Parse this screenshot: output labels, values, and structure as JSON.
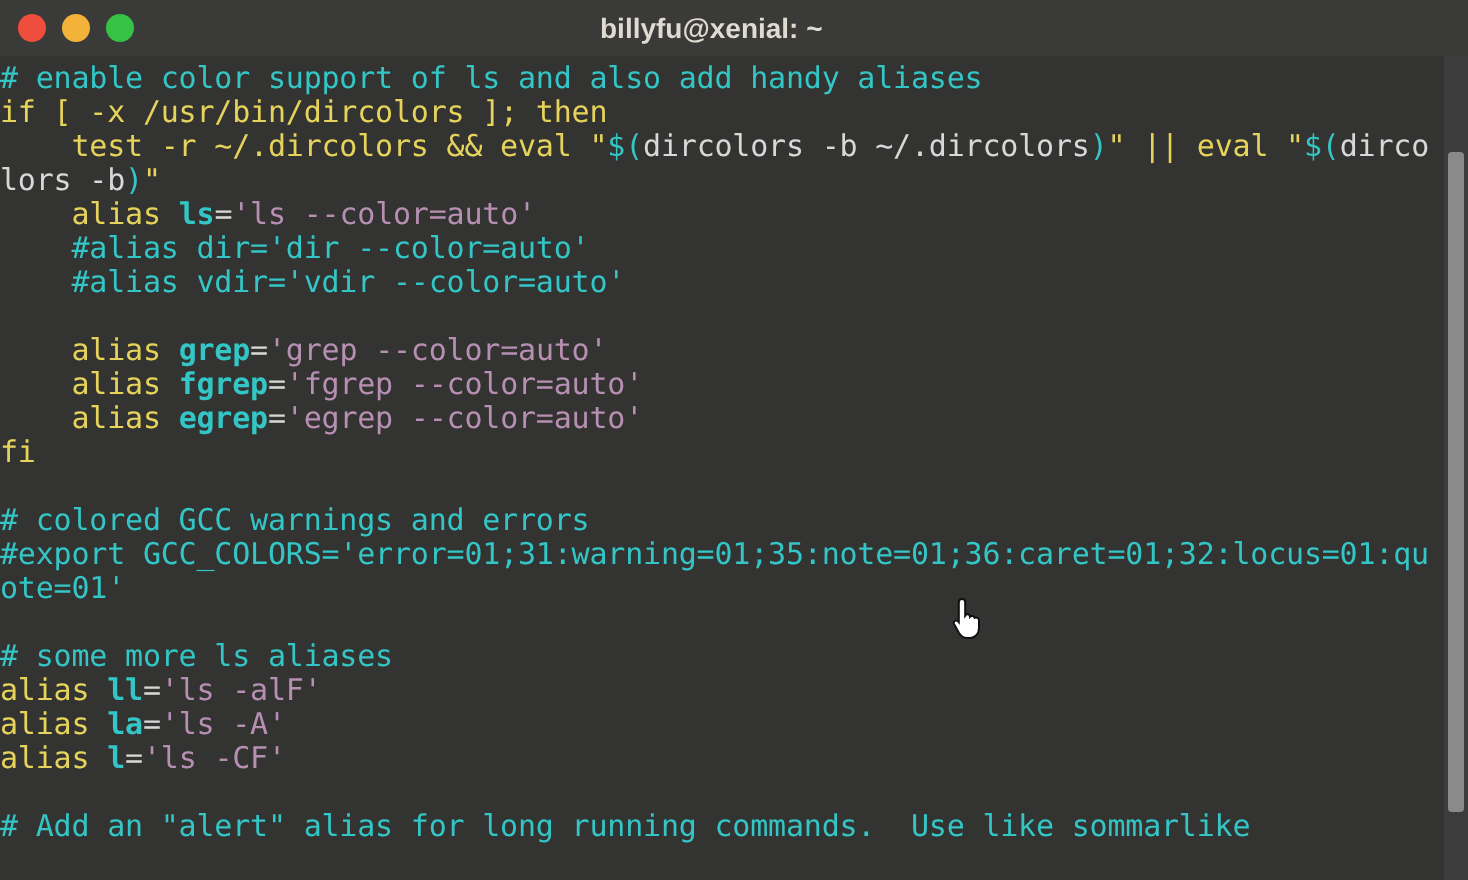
{
  "window": {
    "title": "billyfu@xenial: ~"
  },
  "terminal": {
    "blocks": [
      {
        "lines": [
          [
            {
              "kind": "comment",
              "text": "# enable color support of ls and also add handy aliases"
            }
          ],
          [
            {
              "kind": "keyword",
              "text": "if [ -x /usr/bin/dircolors ]; then"
            }
          ],
          [
            {
              "kind": "keyword",
              "text": "    test -r ~/.dircolors && eval \""
            },
            {
              "kind": "subst",
              "text": "$("
            },
            {
              "kind": "plain",
              "text": "dircolors -b ~/.dircolors"
            },
            {
              "kind": "subst",
              "text": ")"
            },
            {
              "kind": "keyword",
              "text": "\" || eval \""
            },
            {
              "kind": "subst",
              "text": "$("
            },
            {
              "kind": "plain",
              "text": "dirco"
            }
          ],
          [
            {
              "kind": "plain",
              "text": "lors -b"
            },
            {
              "kind": "subst",
              "text": ")"
            },
            {
              "kind": "keyword",
              "text": "\""
            }
          ],
          [
            {
              "kind": "keyword",
              "text": "    alias "
            },
            {
              "kind": "name",
              "text": "ls"
            },
            {
              "kind": "plain",
              "text": "="
            },
            {
              "kind": "string",
              "text": "'ls --color=auto'"
            }
          ],
          [
            {
              "kind": "comment",
              "text": "    #alias dir='dir --color=auto'"
            }
          ],
          [
            {
              "kind": "comment",
              "text": "    #alias vdir='vdir --color=auto'"
            }
          ]
        ]
      },
      {
        "lines": [
          [
            {
              "kind": "keyword",
              "text": "    alias "
            },
            {
              "kind": "name",
              "text": "grep"
            },
            {
              "kind": "plain",
              "text": "="
            },
            {
              "kind": "string",
              "text": "'grep --color=auto'"
            }
          ],
          [
            {
              "kind": "keyword",
              "text": "    alias "
            },
            {
              "kind": "name",
              "text": "fgrep"
            },
            {
              "kind": "plain",
              "text": "="
            },
            {
              "kind": "string",
              "text": "'fgrep --color=auto'"
            }
          ],
          [
            {
              "kind": "keyword",
              "text": "    alias "
            },
            {
              "kind": "name",
              "text": "egrep"
            },
            {
              "kind": "plain",
              "text": "="
            },
            {
              "kind": "string",
              "text": "'egrep --color=auto'"
            }
          ],
          [
            {
              "kind": "keyword",
              "text": "fi"
            }
          ]
        ]
      },
      {
        "lines": [
          [
            {
              "kind": "comment",
              "text": "# colored GCC warnings and errors"
            }
          ],
          [
            {
              "kind": "comment",
              "text": "#export GCC_COLORS='error=01;31:warning=01;35:note=01;36:caret=01;32:locus=01:qu"
            }
          ],
          [
            {
              "kind": "comment",
              "text": "ote=01'"
            }
          ]
        ]
      },
      {
        "lines": [
          [
            {
              "kind": "comment",
              "text": "# some more ls aliases"
            }
          ],
          [
            {
              "kind": "keyword",
              "text": "alias "
            },
            {
              "kind": "name",
              "text": "ll"
            },
            {
              "kind": "plain",
              "text": "="
            },
            {
              "kind": "string",
              "text": "'ls -alF'"
            }
          ],
          [
            {
              "kind": "keyword",
              "text": "alias "
            },
            {
              "kind": "name",
              "text": "la"
            },
            {
              "kind": "plain",
              "text": "="
            },
            {
              "kind": "string",
              "text": "'ls -A'"
            }
          ],
          [
            {
              "kind": "keyword",
              "text": "alias "
            },
            {
              "kind": "name",
              "text": "l"
            },
            {
              "kind": "plain",
              "text": "="
            },
            {
              "kind": "string",
              "text": "'ls -CF'"
            }
          ]
        ]
      },
      {
        "lines": [
          [
            {
              "kind": "comment",
              "text": "# Add an \"alert\" alias for long running commands.  Use like sommarlike"
            }
          ]
        ]
      }
    ]
  }
}
